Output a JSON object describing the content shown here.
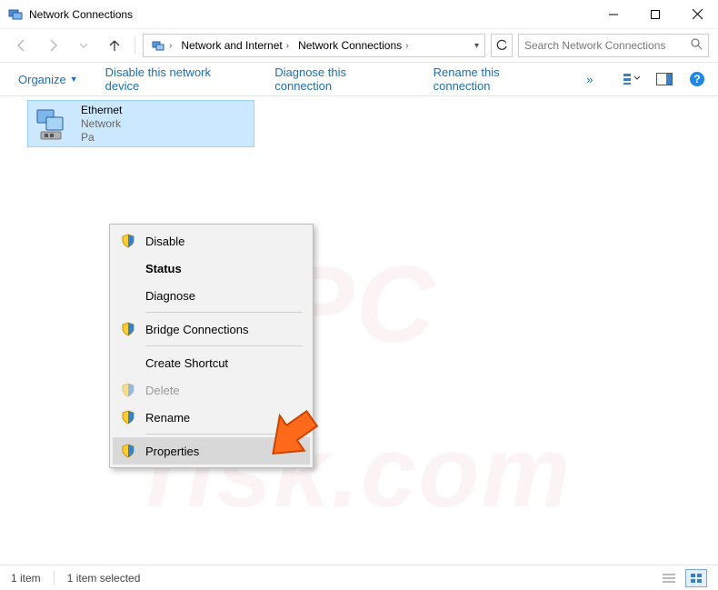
{
  "window": {
    "title": "Network Connections"
  },
  "breadcrumb": {
    "root_icon": "control-panel-icon",
    "items": [
      "Network and Internet",
      "Network Connections"
    ]
  },
  "address": {
    "dropdown_hint": "▾",
    "refresh_hint": "↻"
  },
  "search": {
    "placeholder": "Search Network Connections",
    "icon": "search-icon"
  },
  "commands": {
    "organize": "Organize",
    "disable": "Disable this network device",
    "diagnose": "Diagnose this connection",
    "rename": "Rename this connection",
    "overflow": "»"
  },
  "adapter": {
    "name": "Ethernet",
    "status": "Network",
    "device_prefix": "Pa"
  },
  "context_menu": {
    "disable": "Disable",
    "status": "Status",
    "diagnose": "Diagnose",
    "bridge": "Bridge Connections",
    "create_shortcut": "Create Shortcut",
    "delete": "Delete",
    "rename": "Rename",
    "properties": "Properties"
  },
  "statusbar": {
    "count": "1 item",
    "selected": "1 item selected"
  },
  "watermark": {
    "line1": "PC",
    "line2": "risk.com"
  }
}
